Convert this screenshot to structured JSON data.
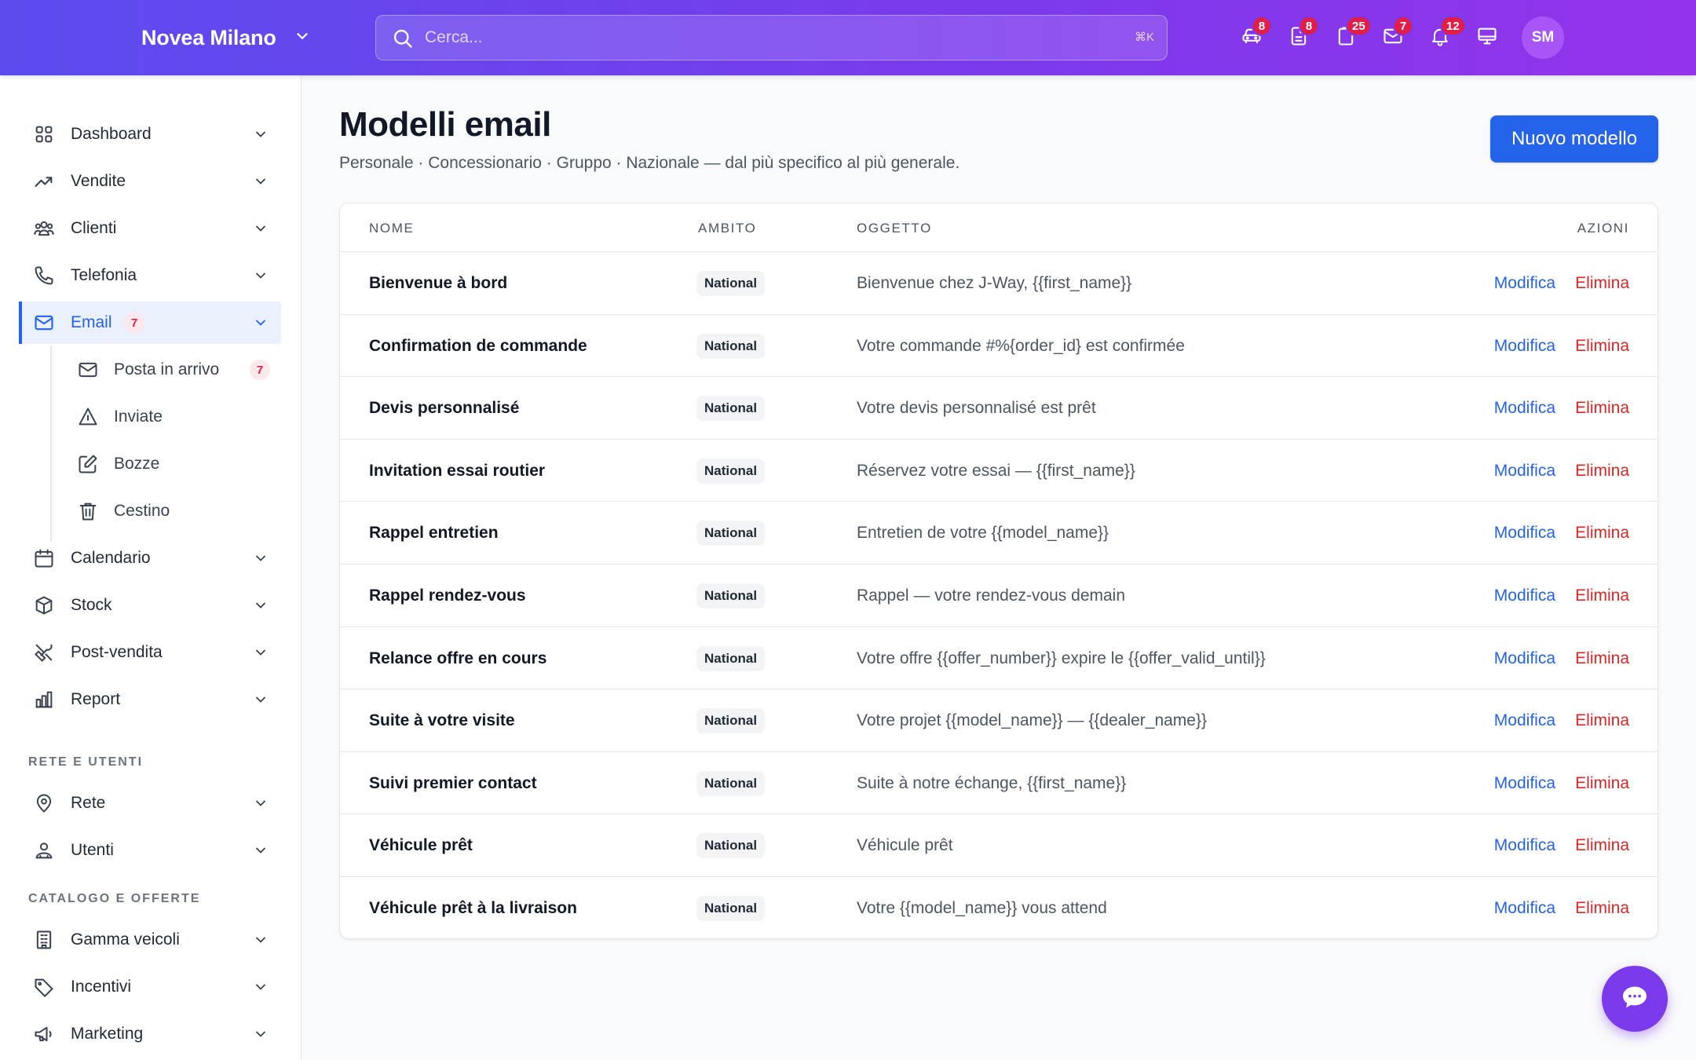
{
  "header": {
    "brand": "Novea Milano",
    "search_placeholder": "Cerca...",
    "search_shortcut": "⌘K",
    "icons": [
      {
        "name": "car-icon",
        "badge": "8"
      },
      {
        "name": "document-icon",
        "badge": "8"
      },
      {
        "name": "clipboard-icon",
        "badge": "25"
      },
      {
        "name": "mail-icon",
        "badge": "7"
      },
      {
        "name": "bell-icon",
        "badge": "12"
      },
      {
        "name": "monitor-icon",
        "badge": ""
      }
    ],
    "avatar": "SM"
  },
  "sidebar": {
    "items": [
      {
        "label": "Dashboard",
        "icon": "grid-icon"
      },
      {
        "label": "Vendite",
        "icon": "trend-icon"
      },
      {
        "label": "Clienti",
        "icon": "users-icon"
      },
      {
        "label": "Telefonia",
        "icon": "phone-icon"
      },
      {
        "label": "Email",
        "icon": "mail-icon",
        "badge": "7",
        "active": true
      },
      {
        "label": "Calendario",
        "icon": "calendar-icon"
      },
      {
        "label": "Stock",
        "icon": "box-icon"
      },
      {
        "label": "Post-vendita",
        "icon": "tools-icon"
      },
      {
        "label": "Report",
        "icon": "chart-icon"
      }
    ],
    "email_sub": [
      {
        "label": "Posta in arrivo",
        "icon": "inbox-icon",
        "badge": "7"
      },
      {
        "label": "Inviate",
        "icon": "send-icon"
      },
      {
        "label": "Bozze",
        "icon": "edit-icon"
      },
      {
        "label": "Cestino",
        "icon": "trash-icon"
      }
    ],
    "section_network": "RETE E UTENTI",
    "network_items": [
      {
        "label": "Rete",
        "icon": "location-icon"
      },
      {
        "label": "Utenti",
        "icon": "user-icon"
      }
    ],
    "section_catalog": "CATALOGO E OFFERTE",
    "catalog_items": [
      {
        "label": "Gamma veicoli",
        "icon": "building-icon"
      },
      {
        "label": "Incentivi",
        "icon": "tag-icon"
      },
      {
        "label": "Marketing",
        "icon": "megaphone-icon"
      }
    ]
  },
  "main": {
    "title": "Modelli email",
    "subtitle": "Personale · Concessionario · Gruppo · Nazionale — dal più specifico al più generale.",
    "new_button": "Nuovo modello",
    "table": {
      "headers": {
        "name": "NOME",
        "scope": "AMBITO",
        "subject": "OGGETTO",
        "actions": "AZIONI"
      },
      "edit_label": "Modifica",
      "delete_label": "Elimina",
      "rows": [
        {
          "name": "Bienvenue à bord",
          "scope": "National",
          "subject": "Bienvenue chez J-Way, {{first_name}}"
        },
        {
          "name": "Confirmation de commande",
          "scope": "National",
          "subject": "Votre commande #%{order_id} est confirmée"
        },
        {
          "name": "Devis personnalisé",
          "scope": "National",
          "subject": "Votre devis personnalisé est prêt"
        },
        {
          "name": "Invitation essai routier",
          "scope": "National",
          "subject": "Réservez votre essai — {{first_name}}"
        },
        {
          "name": "Rappel entretien",
          "scope": "National",
          "subject": "Entretien de votre {{model_name}}"
        },
        {
          "name": "Rappel rendez-vous",
          "scope": "National",
          "subject": "Rappel — votre rendez-vous demain"
        },
        {
          "name": "Relance offre en cours",
          "scope": "National",
          "subject": "Votre offre {{offer_number}} expire le {{offer_valid_until}}"
        },
        {
          "name": "Suite à votre visite",
          "scope": "National",
          "subject": "Votre projet {{model_name}} — {{dealer_name}}"
        },
        {
          "name": "Suivi premier contact",
          "scope": "National",
          "subject": "Suite à notre échange, {{first_name}}"
        },
        {
          "name": "Véhicule prêt",
          "scope": "National",
          "subject": "Véhicule prêt"
        },
        {
          "name": "Véhicule prêt à la livraison",
          "scope": "National",
          "subject": "Votre {{model_name}} vous attend"
        }
      ]
    }
  },
  "colors": {
    "accent": "#2563eb",
    "danger": "#dc2626",
    "header_start": "#5b4cf0",
    "header_end": "#9333ea",
    "badge": "#e11d48"
  }
}
